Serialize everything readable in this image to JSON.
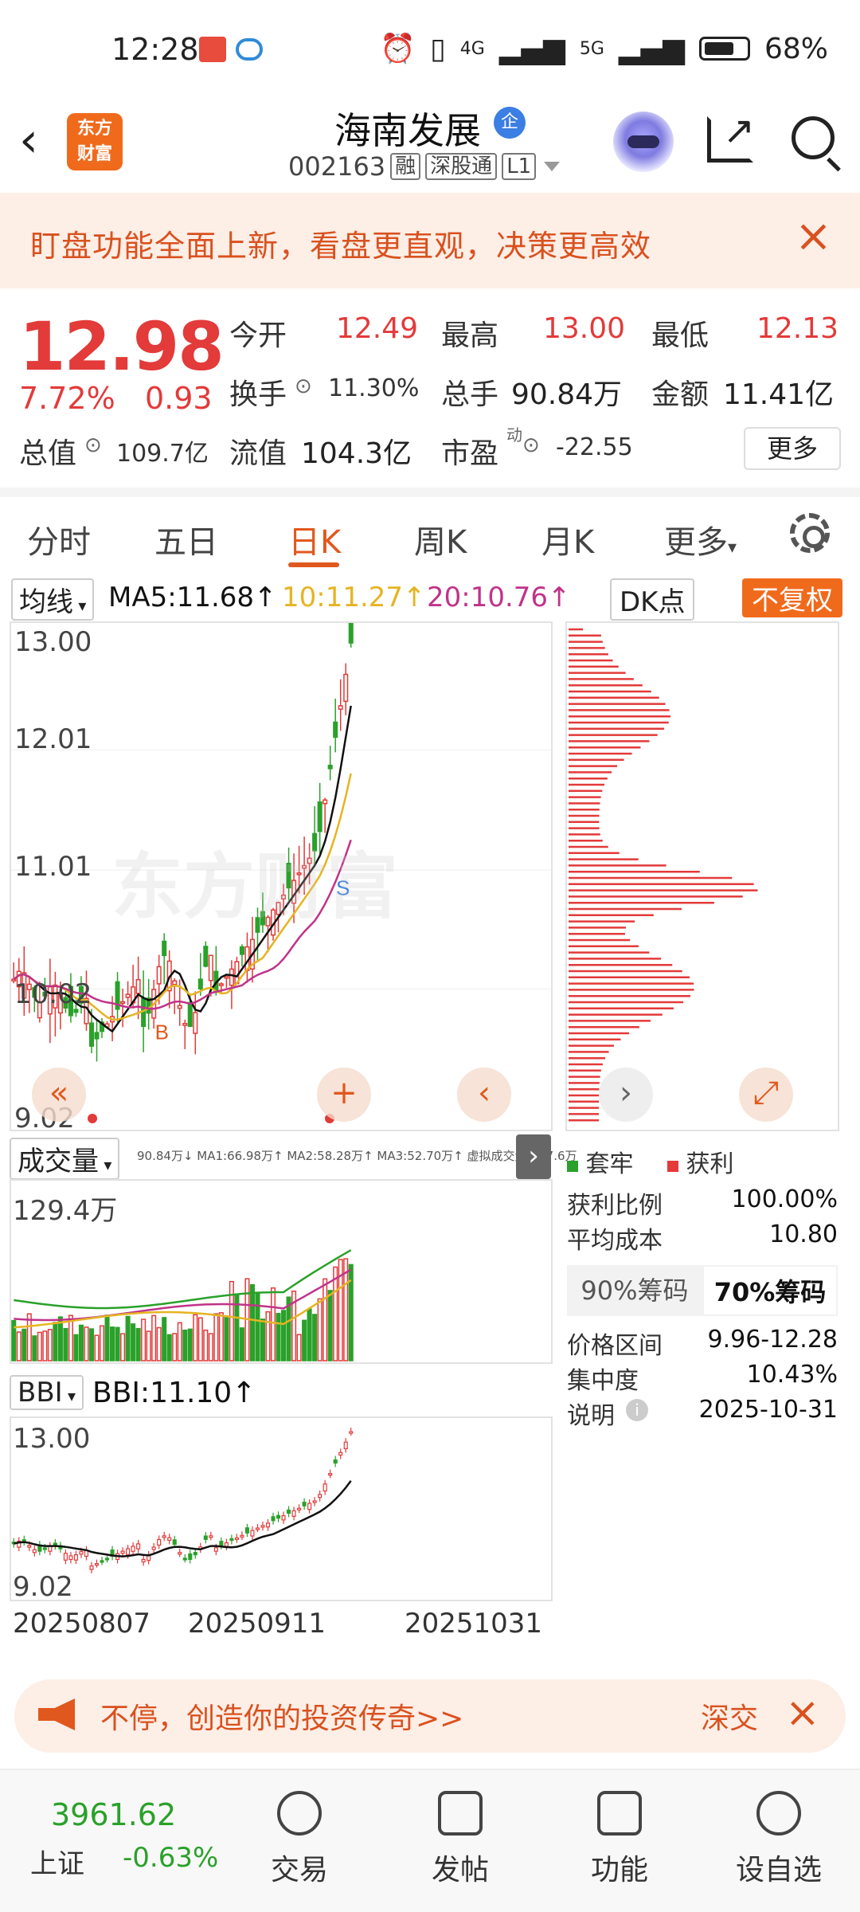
{
  "status_bar": {
    "time": "12:28",
    "net1": "4G",
    "net2": "5G",
    "battery": "68%"
  },
  "header": {
    "logo_text": "东方\n财富",
    "stock_name": "海南发展",
    "qi_badge": "企",
    "code": "002163",
    "tags": [
      "融",
      "深股通",
      "L1"
    ]
  },
  "banner": {
    "text": "盯盘功能全面上新，看盘更直观，决策更高效"
  },
  "quote": {
    "price": "12.98",
    "change_pct": "7.72%",
    "change": "0.93",
    "open_label": "今开",
    "open": "12.49",
    "high_label": "最高",
    "high": "13.00",
    "low_label": "最低",
    "low": "12.13",
    "turnover_label": "换手",
    "turnover": "11.30%",
    "vol_label": "总手",
    "vol": "90.84万",
    "amount_label": "金额",
    "amount": "11.41亿",
    "mktcap_label": "总值",
    "mktcap": "109.7亿",
    "float_label": "流值",
    "float": "104.3亿",
    "pe_label": "市盈",
    "pe_sup": "动",
    "pe": "-22.55",
    "more": "更多"
  },
  "tabs": [
    "分时",
    "五日",
    "日K",
    "周K",
    "月K",
    "更多"
  ],
  "active_tab": "日K",
  "ma_row": {
    "selector": "均线",
    "ma5": "MA5:11.68↑",
    "ma10": "10:11.27↑",
    "ma20": "20:10.76↑",
    "dk": "DK点",
    "adjust": "不复权"
  },
  "kline": {
    "y_labels": [
      "13.00",
      "12.01",
      "11.01",
      "10.02",
      "9.02"
    ],
    "watermark": "东方财富",
    "mark_b": "B",
    "mark_s": "S"
  },
  "volume": {
    "selector": "成交量",
    "legend": "90.84万↓ MA1:66.98万↑ MA2:58.28万↑ MA3:52.70万↑ 虚拟成交量:117.6万",
    "max": "129.4万"
  },
  "bbi": {
    "selector": "BBI",
    "value": "BBI:11.10↑",
    "y_top": "13.00",
    "y_bottom": "9.02"
  },
  "dates": [
    "20250807",
    "20250911",
    "20251031"
  ],
  "chips": {
    "legend_trapped": "套牢",
    "legend_profit": "获利",
    "rows": [
      {
        "label": "获利比例",
        "value": "100.00%"
      },
      {
        "label": "平均成本",
        "value": "10.80"
      }
    ],
    "tab90": "90%筹码",
    "tab70": "70%筹码",
    "rows2": [
      {
        "label": "价格区间",
        "value": "9.96-12.28"
      },
      {
        "label": "集中度",
        "value": "10.43%"
      },
      {
        "label": "说明",
        "value": "2025-10-31"
      }
    ]
  },
  "ad": {
    "text": "不停，创造你的投资传奇>>",
    "source": "深交"
  },
  "bottom_nav": {
    "index_value": "3961.62",
    "index_name": "上证",
    "index_change": "-0.63%",
    "items": [
      "交易",
      "发帖",
      "功能",
      "设自选"
    ]
  },
  "colors": {
    "up": "#e33a3a",
    "down": "#2aa12a",
    "accent": "#e0581e",
    "ma5": "#111111",
    "ma10": "#e6b422",
    "ma20": "#c0338a"
  }
}
